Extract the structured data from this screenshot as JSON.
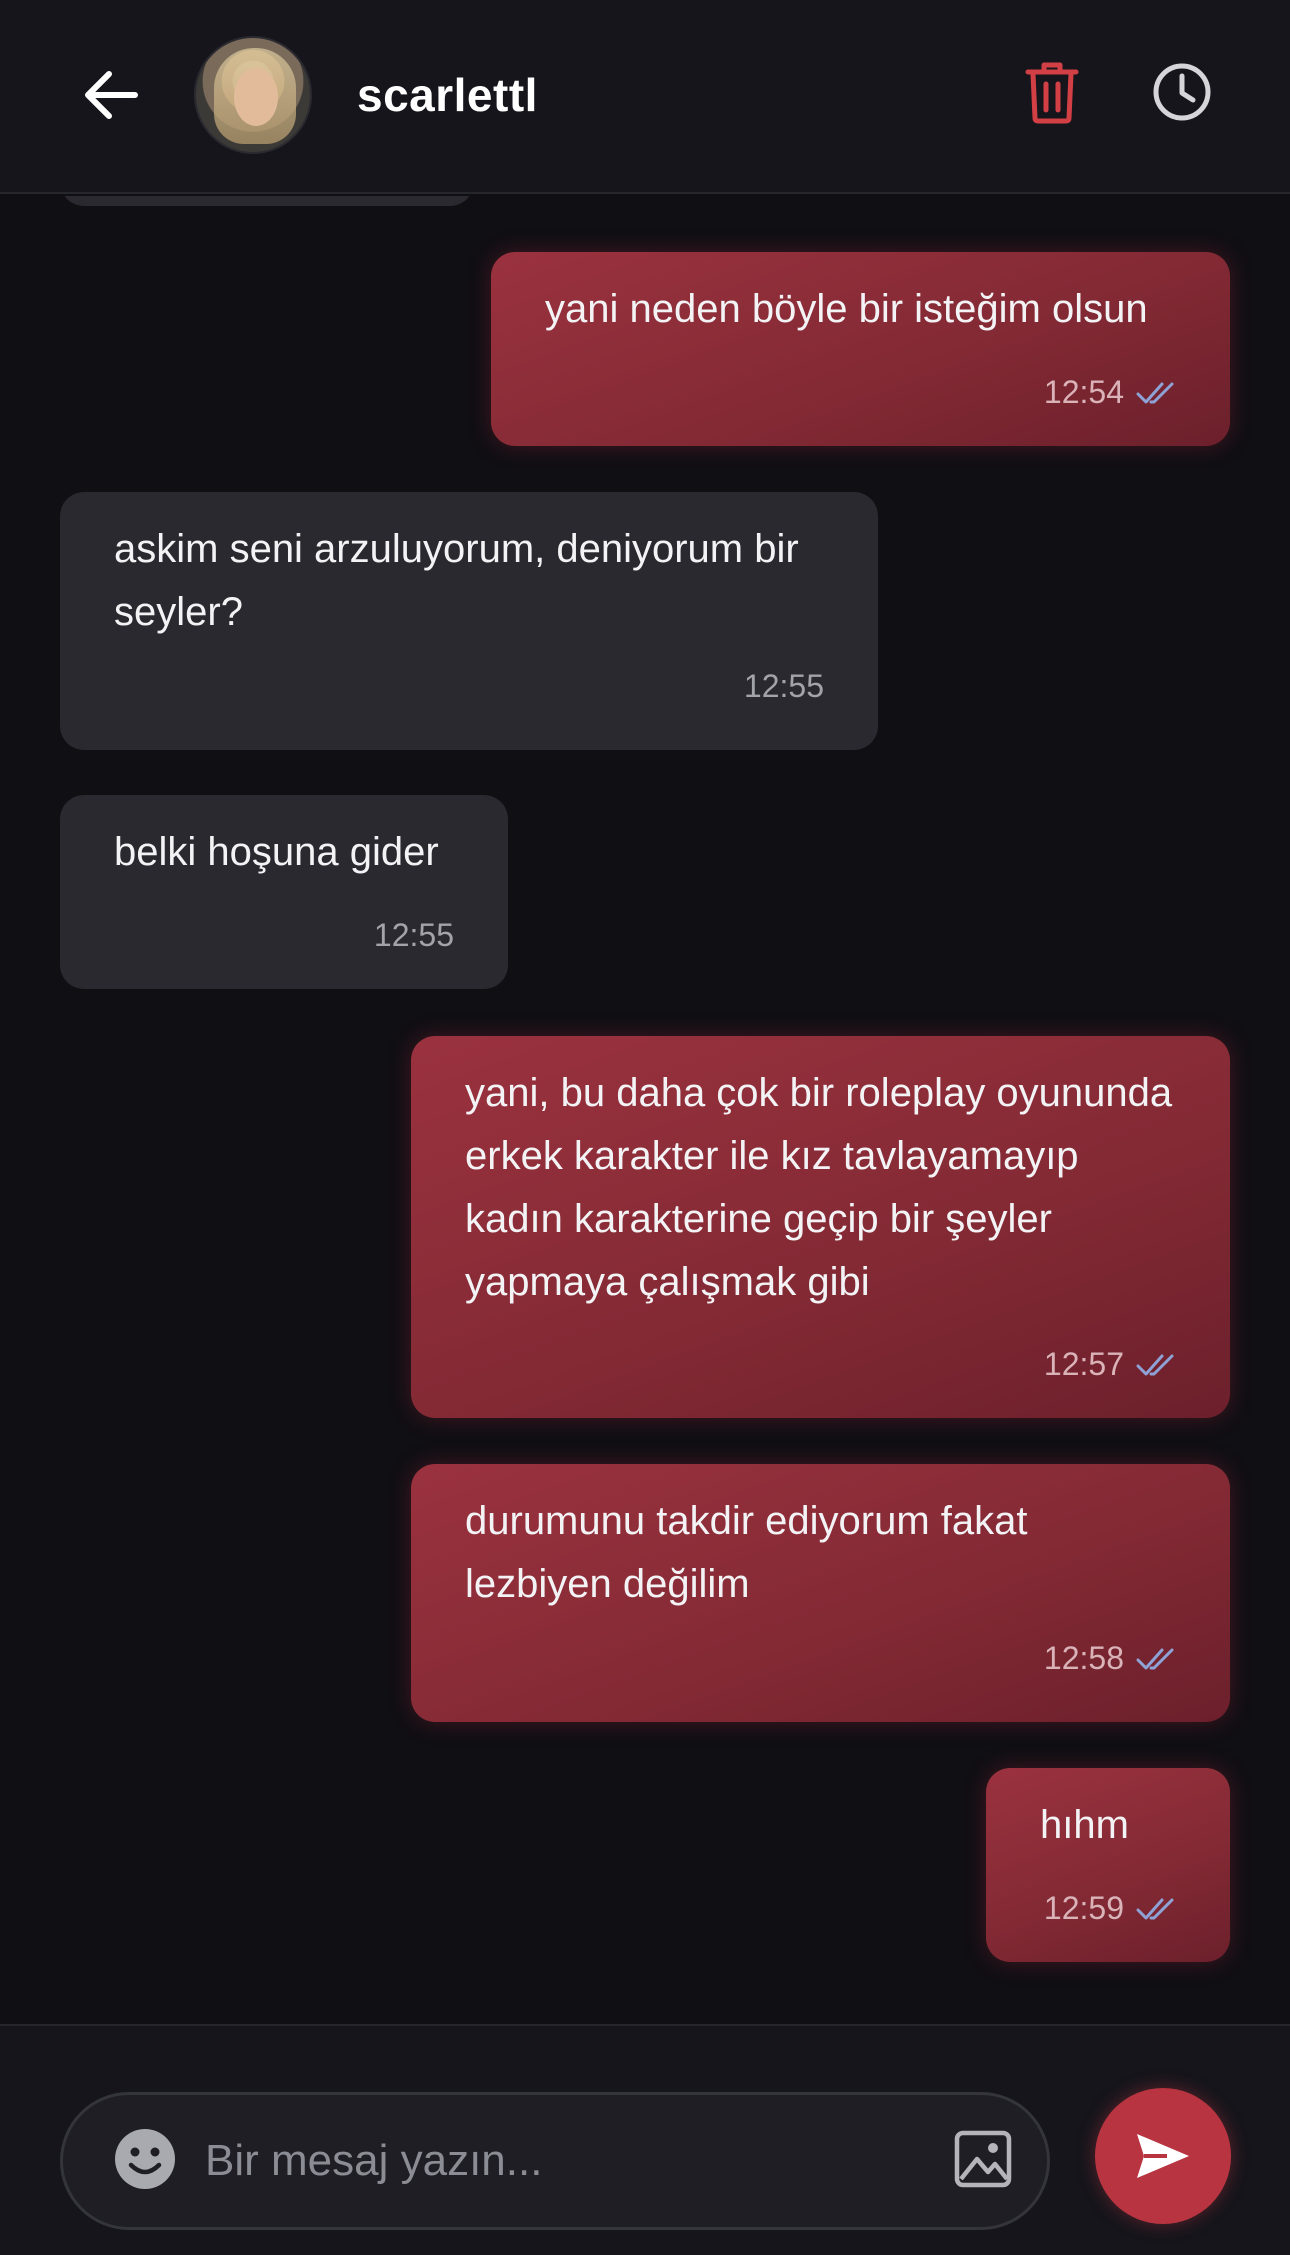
{
  "header": {
    "contact_name": "scarlettl",
    "icons": {
      "back": "arrow-left-icon",
      "delete": "trash-icon",
      "history": "clock-icon"
    }
  },
  "messages": [
    {
      "direction": "out",
      "text": "yani neden böyle bir isteğim olsun",
      "time": "12:54",
      "read": true
    },
    {
      "direction": "in",
      "text": "askim seni arzuluyorum, deniyorum bir seyler?",
      "time": "12:55"
    },
    {
      "direction": "in",
      "text": "belki hoşuna gider",
      "time": "12:55"
    },
    {
      "direction": "out",
      "text": "yani, bu daha çok bir roleplay oyununda erkek karakter ile kız tavlayamayıp kadın karakterine geçip bir şeyler yapmaya çalışmak gibi",
      "time": "12:57",
      "read": true
    },
    {
      "direction": "out",
      "text": "durumunu takdir ediyorum fakat lezbiyen değilim",
      "time": "12:58",
      "read": true
    },
    {
      "direction": "out",
      "text": "hıhm",
      "time": "12:59",
      "read": true
    }
  ],
  "composer": {
    "placeholder": "Bir mesaj yazın...",
    "value": "",
    "icons": {
      "emoji": "smiley-icon",
      "attach": "image-icon",
      "send": "send-icon"
    }
  },
  "colors": {
    "background": "#100f14",
    "header": "#15151b",
    "incoming_bubble": "#2a292f",
    "outgoing_bubble": "#8b2c38",
    "accent": "#b73440",
    "read_ticks": "#8fa2d6"
  }
}
